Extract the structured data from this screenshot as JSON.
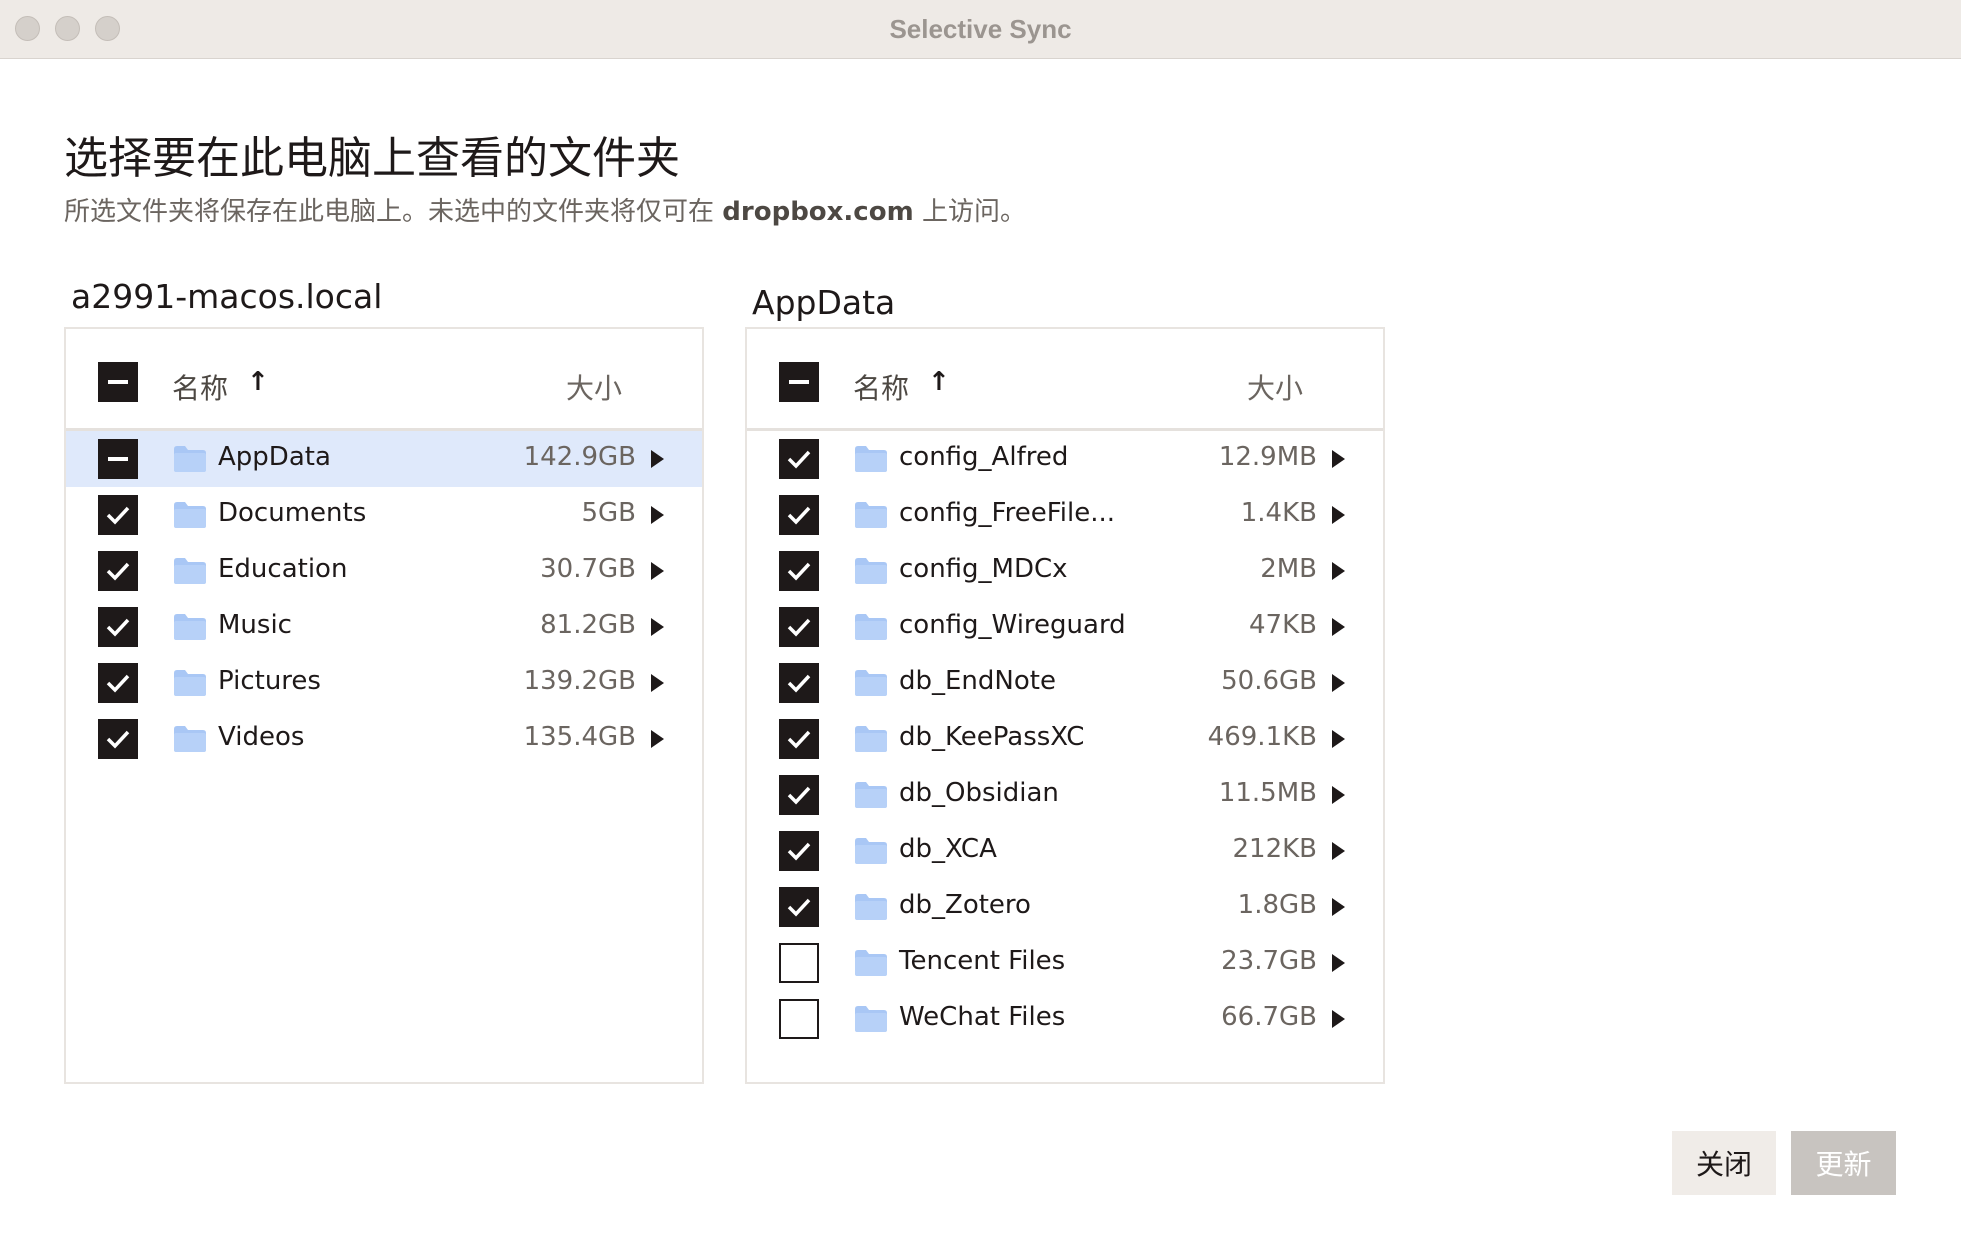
{
  "window": {
    "title": "Selective Sync"
  },
  "heading": "选择要在此电脑上查看的文件夹",
  "subheading": {
    "before": "所选文件夹将保存在此电脑上。未选中的文件夹将仅可在",
    "domain": "dropbox.com",
    "after": "上访问。"
  },
  "columns": {
    "name": "名称",
    "sort_arrow": "↑",
    "size": "大小"
  },
  "left_panel": {
    "title": "a2991-macos.local",
    "header_state": "partial",
    "rows": [
      {
        "name": "AppData",
        "size": "142.9GB",
        "state": "partial",
        "selected": true
      },
      {
        "name": "Documents",
        "size": "5GB",
        "state": "checked"
      },
      {
        "name": "Education",
        "size": "30.7GB",
        "state": "checked"
      },
      {
        "name": "Music",
        "size": "81.2GB",
        "state": "checked"
      },
      {
        "name": "Pictures",
        "size": "139.2GB",
        "state": "checked"
      },
      {
        "name": "Videos",
        "size": "135.4GB",
        "state": "checked"
      }
    ]
  },
  "right_panel": {
    "title": "AppData",
    "header_state": "partial",
    "rows": [
      {
        "name": "config_Alfred",
        "size": "12.9MB",
        "state": "checked"
      },
      {
        "name": "config_FreeFile...",
        "size": "1.4KB",
        "state": "checked"
      },
      {
        "name": "config_MDCx",
        "size": "2MB",
        "state": "checked"
      },
      {
        "name": "config_Wireguard",
        "size": "47KB",
        "state": "checked"
      },
      {
        "name": "db_EndNote",
        "size": "50.6GB",
        "state": "checked"
      },
      {
        "name": "db_KeePassXC",
        "size": "469.1KB",
        "state": "checked"
      },
      {
        "name": "db_Obsidian",
        "size": "11.5MB",
        "state": "checked"
      },
      {
        "name": "db_XCA",
        "size": "212KB",
        "state": "checked"
      },
      {
        "name": "db_Zotero",
        "size": "1.8GB",
        "state": "checked"
      },
      {
        "name": "Tencent Files",
        "size": "23.7GB",
        "state": "unchecked"
      },
      {
        "name": "WeChat Files",
        "size": "66.7GB",
        "state": "unchecked"
      }
    ]
  },
  "buttons": {
    "close": "关闭",
    "update": "更新"
  },
  "colors": {
    "selected_row": "#dfe9fb",
    "folder": "#a9c7f5",
    "checkbox": "#1e1919"
  },
  "icons": {
    "folder": "folder-icon",
    "expand": "expand-arrow-icon",
    "check": "check-icon"
  }
}
